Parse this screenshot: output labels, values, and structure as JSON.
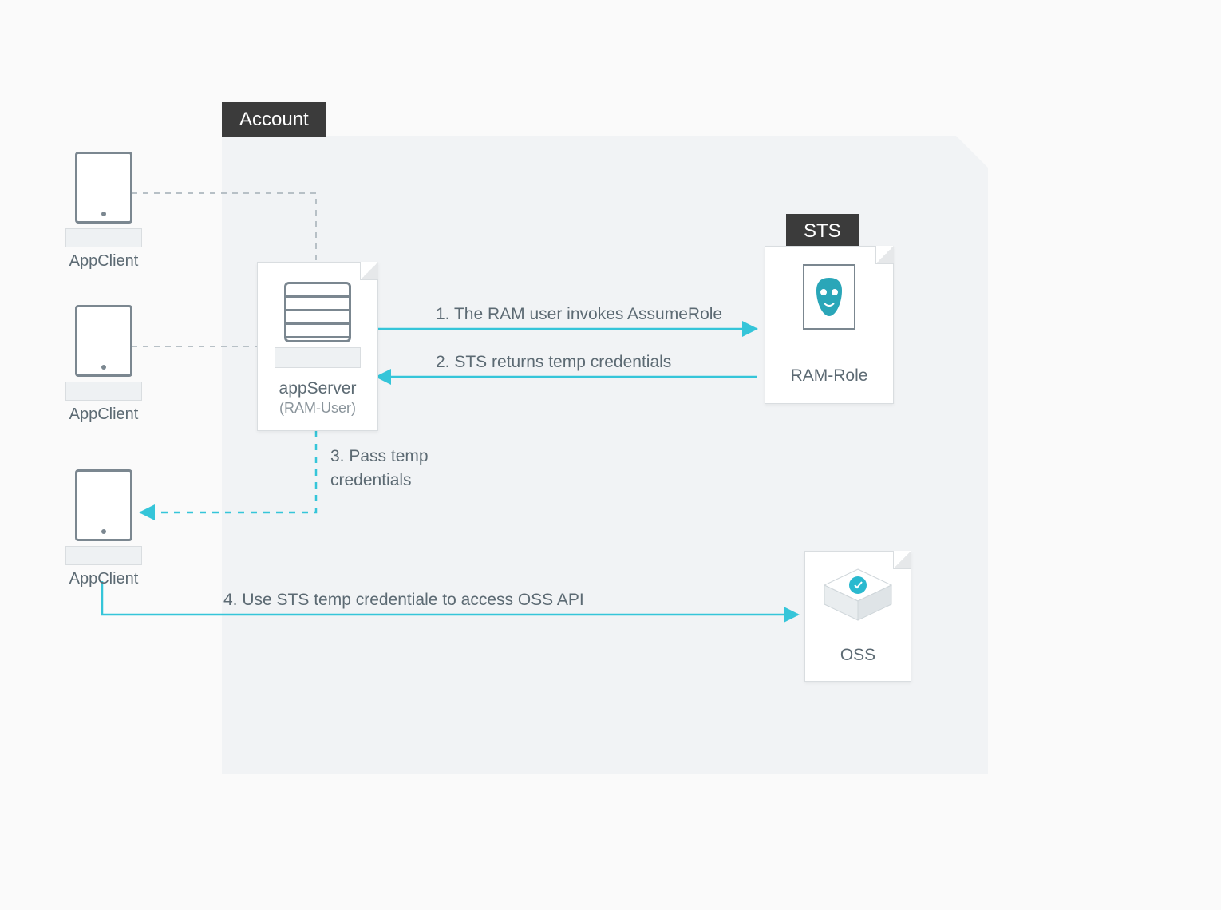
{
  "tags": {
    "account": "Account",
    "sts": "STS"
  },
  "clients": {
    "c1": "AppClient",
    "c2": "AppClient",
    "c3": "AppClient"
  },
  "server": {
    "title": "appServer",
    "sub": "(RAM-User)"
  },
  "role": {
    "title": "RAM-Role"
  },
  "oss": {
    "title": "OSS"
  },
  "flows": {
    "f1": "1. The RAM user invokes AssumeRole",
    "f2": "2. STS returns temp credentials",
    "f3a": "3. Pass temp",
    "f3b": "credentials",
    "f4": "4. Use STS temp credentiale to access OSS API"
  },
  "colors": {
    "arrow": "#35c5d9",
    "dash": "#b7c0c6"
  }
}
